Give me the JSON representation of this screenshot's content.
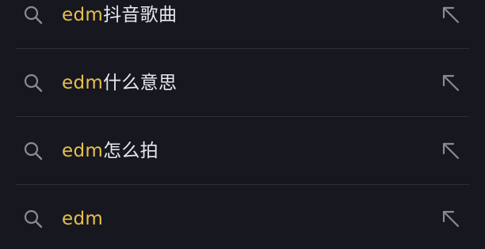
{
  "theme": {
    "background": "#171720",
    "highlight": "#e7c04a",
    "text": "#e8e8ee",
    "icon": "#8a8a94",
    "divider": "#2d2d38"
  },
  "suggestions": [
    {
      "query": "edm",
      "suffix": "抖音歌曲",
      "leading_icon": "search-icon",
      "trailing_icon": "fill-query-arrow-icon"
    },
    {
      "query": "edm",
      "suffix": "什么意思",
      "leading_icon": "search-icon",
      "trailing_icon": "fill-query-arrow-icon"
    },
    {
      "query": "edm",
      "suffix": "怎么拍",
      "leading_icon": "search-icon",
      "trailing_icon": "fill-query-arrow-icon"
    },
    {
      "query": "edm",
      "suffix": "",
      "leading_icon": "search-icon",
      "trailing_icon": "fill-query-arrow-icon"
    }
  ]
}
